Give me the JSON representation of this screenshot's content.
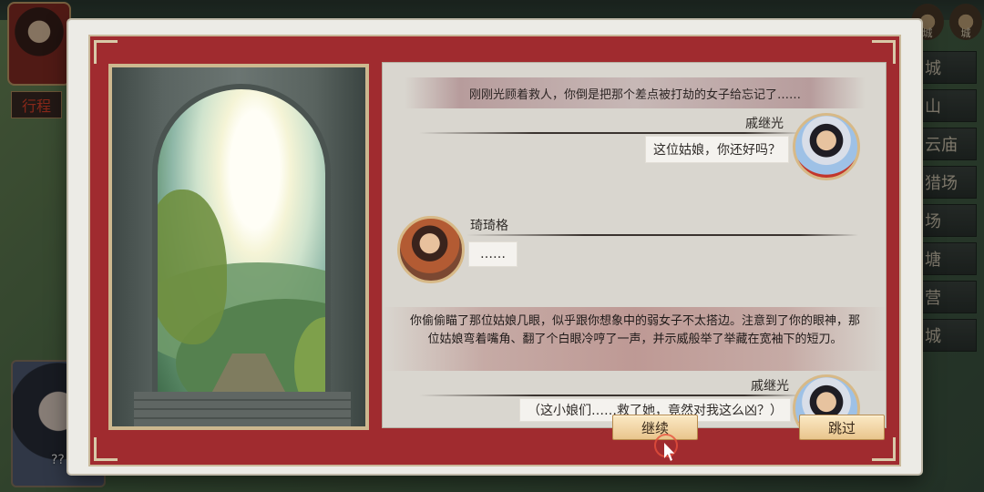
{
  "background": {
    "tag_label": "行程",
    "bottom_portrait_text": "??",
    "right_icons": [
      "城",
      "城"
    ],
    "right_menu": [
      "城",
      "山",
      "云庙",
      "猎场",
      "场",
      "塘",
      "营",
      "城"
    ]
  },
  "dialog": {
    "narration_top": "刚刚光顾着救人，你倒是把那个差点被打劫的女子给忘记了……",
    "messages": [
      {
        "speaker": "戚继光",
        "text": "这位姑娘，你还好吗？"
      },
      {
        "speaker": "琦琦格",
        "text": "……"
      }
    ],
    "narration_long": "你偷偷瞄了那位姑娘几眼，似乎跟你想象中的弱女子不太搭边。注意到了你的眼神，那位姑娘弯着嘴角、翻了个白眼冷哼了一声，并示威般举了举藏在宽袖下的短刀。",
    "last_message": {
      "speaker": "戚继光",
      "text": "（这小娘们……救了她，竟然对我这么凶？）"
    },
    "buttons": {
      "continue": "继续",
      "skip": "跳过"
    }
  }
}
